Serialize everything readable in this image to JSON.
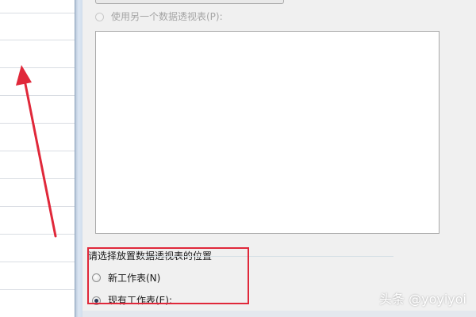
{
  "dialog": {
    "use_external_option_label": "使用另一个数据透视表(P):",
    "placement_group_title": "请选择放置数据透视表的位置",
    "new_sheet_label": "新工作表(N)",
    "existing_sheet_label": "现有工作表(E):",
    "new_sheet_checked": false,
    "existing_sheet_checked": true
  },
  "annotation": {
    "highlight_color": "#e0283a",
    "arrow_color": "#e0283a"
  },
  "watermark": {
    "text": "头条 @yoyiyoi"
  }
}
